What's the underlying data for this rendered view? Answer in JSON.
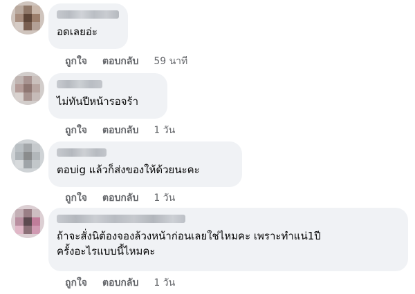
{
  "actions": {
    "like_label": "ถูกใจ",
    "reply_label": "ตอบกลับ"
  },
  "comments": [
    {
      "text_lines": [
        "อดเลยอ่ะ"
      ],
      "time": "59 นาที"
    },
    {
      "text_lines": [
        "ไม่ทันปีหน้ารอจร้า"
      ],
      "time": "1 วัน"
    },
    {
      "text_lines": [
        "ตอบig แล้วก็ส่งของให้ด้วยนะคะ"
      ],
      "time": "1 วัน"
    },
    {
      "text_lines": [
        "ถ้าจะสั่งนิต้องจองล้วงหน้าก่อนเลยใช่ไหมคะ เพราะทำแน่1ปี",
        "ครั้งอะไรแบบนี้ไหมคะ"
      ],
      "time": "1 วัน"
    }
  ],
  "colors": {
    "bubble": "#f0f2f5",
    "action_text": "#65676b",
    "body_text": "#050505"
  }
}
